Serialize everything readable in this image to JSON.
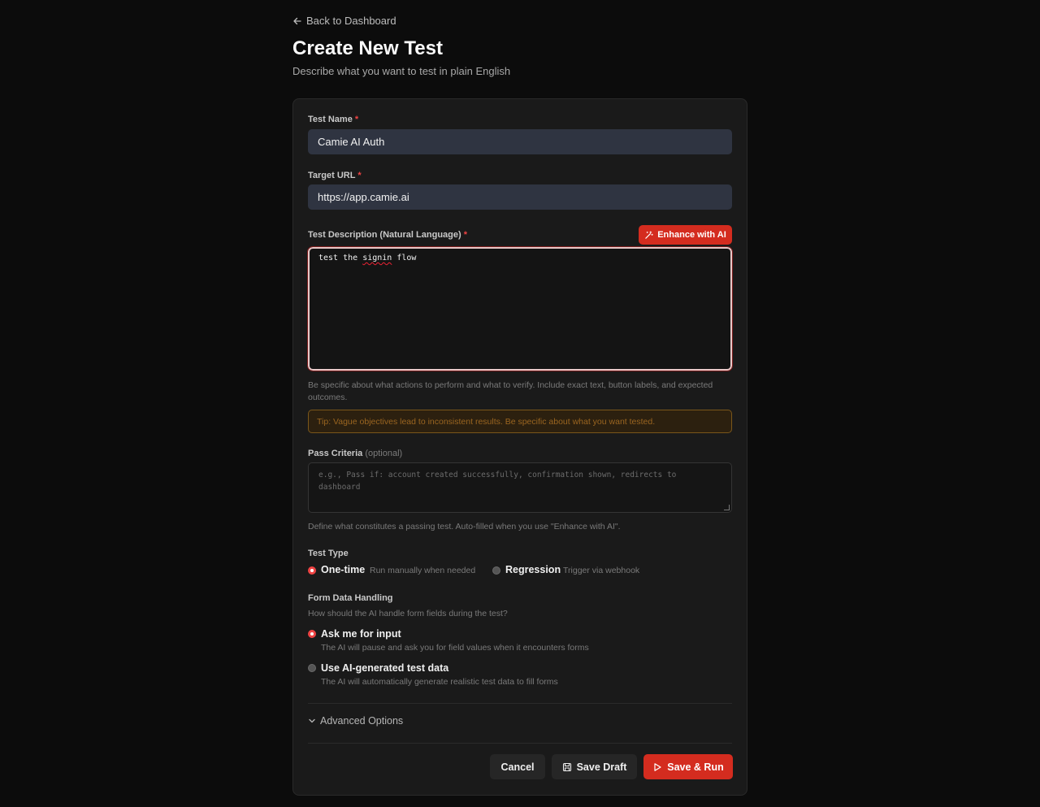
{
  "nav": {
    "back_label": "Back to Dashboard"
  },
  "header": {
    "title": "Create New Test",
    "subtitle": "Describe what you want to test in plain English"
  },
  "form": {
    "test_name": {
      "label": "Test Name",
      "required_mark": "*",
      "value": "Camie AI Auth"
    },
    "target_url": {
      "label": "Target URL",
      "required_mark": "*",
      "value": "https://app.camie.ai"
    },
    "description": {
      "label": "Test Description (Natural Language)",
      "required_mark": "*",
      "value_before": "test the ",
      "value_misspelled": "signin",
      "value_after": " flow",
      "enhance_label": "Enhance with AI",
      "help": "Be specific about what actions to perform and what to verify. Include exact text, button labels, and expected outcomes.",
      "tip": "Tip: Vague objectives lead to inconsistent results. Be specific about what you want tested."
    },
    "pass_criteria": {
      "label": "Pass Criteria",
      "optional": "(optional)",
      "placeholder": "e.g., Pass if: account created successfully, confirmation shown, redirects to dashboard",
      "help": "Define what constitutes a passing test. Auto-filled when you use \"Enhance with AI\"."
    },
    "test_type": {
      "label": "Test Type",
      "options": [
        {
          "label": "One-time",
          "hint": "Run manually when needed",
          "selected": true
        },
        {
          "label": "Regression",
          "hint": "Trigger via webhook",
          "selected": false
        }
      ]
    },
    "form_data": {
      "label": "Form Data Handling",
      "hint": "How should the AI handle form fields during the test?",
      "options": [
        {
          "label": "Ask me for input",
          "desc": "The AI will pause and ask you for field values when it encounters forms",
          "selected": true
        },
        {
          "label": "Use AI-generated test data",
          "desc": "The AI will automatically generate realistic test data to fill forms",
          "selected": false
        }
      ]
    },
    "advanced_label": "Advanced Options"
  },
  "actions": {
    "cancel": "Cancel",
    "save_draft": "Save Draft",
    "save_run": "Save & Run"
  },
  "colors": {
    "accent": "#d42c1f",
    "background": "#0c0c0c",
    "card": "#1a1a1a",
    "input": "#2f3441"
  }
}
